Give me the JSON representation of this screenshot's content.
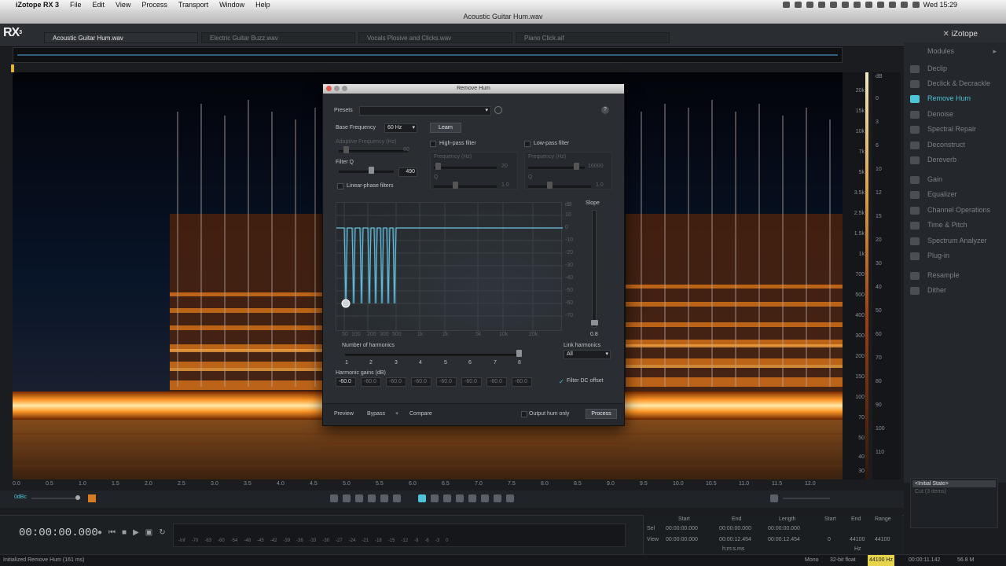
{
  "menubar": {
    "app": "iZotope RX 3",
    "items": [
      "File",
      "Edit",
      "View",
      "Process",
      "Transport",
      "Window",
      "Help"
    ],
    "clock": "Wed 15:29"
  },
  "window": {
    "title": "Acoustic Guitar Hum.wav"
  },
  "logo": {
    "text": "RX",
    "sup": "3"
  },
  "tabs": [
    {
      "label": "Acoustic Guitar Hum.wav",
      "active": true
    },
    {
      "label": "Electric Guitar Buzz.wav",
      "active": false
    },
    {
      "label": "Vocals Plosive and Clicks.wav",
      "active": false
    },
    {
      "label": "Piano Click.aif",
      "active": false
    }
  ],
  "brand": "iZotope",
  "time_ticks": [
    "0.0",
    "0.5",
    "1.0",
    "1.5",
    "2.0",
    "2.5",
    "3.0",
    "3.5",
    "4.0",
    "4.5",
    "5.0",
    "5.5",
    "6.0",
    "6.5",
    "7.0",
    "7.5",
    "8.0",
    "8.5",
    "9.0",
    "9.5",
    "10.0",
    "10.5",
    "11.0",
    "11.5",
    "12.0"
  ],
  "freq_ticks": [
    "20k",
    "15k",
    "10k",
    "7k",
    "5k",
    "3.5k",
    "2.5k",
    "1.5k",
    "1k",
    "700",
    "500",
    "400",
    "300",
    "200",
    "150",
    "100",
    "70",
    "50",
    "40",
    "30"
  ],
  "db_ticks": [
    "dB",
    "0",
    "3",
    "6",
    "10",
    "12",
    "15",
    "20",
    "30",
    "40",
    "50",
    "60",
    "70",
    "80",
    "90",
    "100",
    "110"
  ],
  "modules": {
    "header": "Modules",
    "items": [
      {
        "label": "Declip",
        "active": false
      },
      {
        "label": "Declick & Decrackle",
        "active": false
      },
      {
        "label": "Remove Hum",
        "active": true
      },
      {
        "label": "Denoise",
        "active": false
      },
      {
        "label": "Spectral Repair",
        "active": false
      },
      {
        "label": "Deconstruct",
        "active": false
      },
      {
        "label": "Dereverb",
        "active": false
      },
      {
        "label": "Gain",
        "active": false
      },
      {
        "label": "Equalizer",
        "active": false
      },
      {
        "label": "Channel Operations",
        "active": false
      },
      {
        "label": "Time & Pitch",
        "active": false
      },
      {
        "label": "Spectrum Analyzer",
        "active": false
      },
      {
        "label": "Plug-in",
        "active": false
      },
      {
        "label": "Resample",
        "active": false
      },
      {
        "label": "Dither",
        "active": false
      }
    ]
  },
  "history": {
    "state": "<Initial State>",
    "sub": "Cut (3 items)"
  },
  "transport": {
    "timecode": "00:00:00.000",
    "ruler": [
      "-Inf",
      "-70",
      "-63",
      "-60",
      "-54",
      "-48",
      "-45",
      "-42",
      "-39",
      "-36",
      "-33",
      "-30",
      "-27",
      "-24",
      "-21",
      "-18",
      "-15",
      "-12",
      "-9",
      "-6",
      "-3",
      "0"
    ]
  },
  "selection": {
    "headers": [
      "Start",
      "End",
      "Length",
      "Start",
      "End",
      "Range"
    ],
    "sel": {
      "label": "Sel",
      "start": "00:00:00.000",
      "end": "00:00:00.000",
      "length": "00:00:00.000"
    },
    "view": {
      "label": "View",
      "start": "00:00:00.000",
      "end": "00:00:12.454",
      "length": "00:00:12.454",
      "fstart": "0",
      "fend": "44100",
      "frange": "44100"
    },
    "unit": "h:m:s.ms",
    "hz": "Hz"
  },
  "status": {
    "left": "Initialized Remove Hum (161 ms)",
    "mono": "Mono",
    "float": "32-bit float",
    "rate": "44100 Hz",
    "len": "00:00:11.142",
    "size": "56.8 M"
  },
  "dialog": {
    "title": "Remove Hum",
    "presets_label": "Presets",
    "base_freq_label": "Base Frequency",
    "base_freq_value": "60 Hz",
    "learn_label": "Learn",
    "adaptive_label": "Adaptive Frequency (Hz)",
    "adaptive_value": "60",
    "highpass_label": "High-pass filter",
    "lowpass_label": "Low-pass filter",
    "filterq_label": "Filter Q",
    "filterq_value": "490",
    "linear_phase_label": "Linear-phase filters",
    "hp_freq_label": "Frequency (Hz)",
    "hp_freq_value": "20",
    "hp_q_label": "Q",
    "hp_q_value": "1.0",
    "lp_freq_label": "Frequency (Hz)",
    "lp_freq_value": "16000",
    "lp_q_label": "Q",
    "lp_q_value": "1.0",
    "graph_db_ticks": [
      "dB",
      "10",
      "0",
      "-10",
      "-20",
      "-30",
      "-40",
      "-50",
      "-60",
      "-70"
    ],
    "graph_freq_ticks": [
      "50",
      "100",
      "200",
      "300",
      "500",
      "1k",
      "2k",
      "5k",
      "10k",
      "20k"
    ],
    "slope_label": "Slope",
    "slope_value": "0.8",
    "harmonics_label": "Number of harmonics",
    "harmonic_numbers": [
      "1",
      "2",
      "3",
      "4",
      "5",
      "6",
      "7",
      "8"
    ],
    "link_harmonics_label": "Link harmonics",
    "link_harmonics_value": "All",
    "gains_label": "Harmonic gains (dB)",
    "gains": [
      "-60.0",
      "-60.0",
      "-60.0",
      "-60.0",
      "-60.0",
      "-60.0",
      "-60.0",
      "-60.0"
    ],
    "filter_dc_label": "Filter DC offset",
    "preview_label": "Preview",
    "bypass_label": "Bypass",
    "compare_label": "Compare",
    "output_hum_label": "Output hum only",
    "process_label": "Process"
  },
  "toolbar": {
    "zoom_label": "0dBc"
  }
}
